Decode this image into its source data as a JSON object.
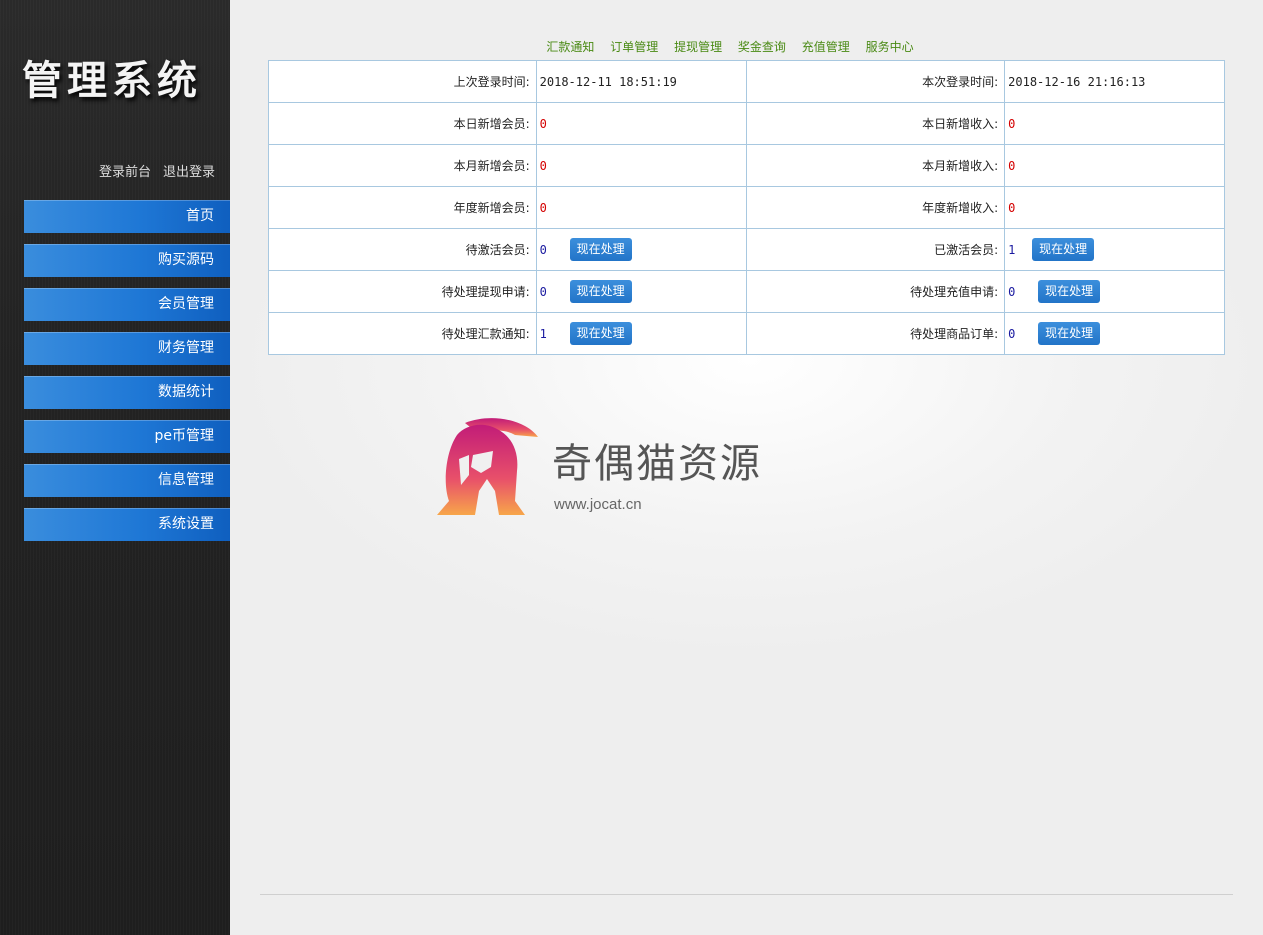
{
  "sidebar": {
    "title": "管理系统",
    "top_links": [
      "登录前台",
      "退出登录"
    ],
    "nav": [
      "首页",
      "购买源码",
      "会员管理",
      "财务管理",
      "数据统计",
      "pe币管理",
      "信息管理",
      "系统设置"
    ]
  },
  "menu": [
    "汇款通知",
    "订单管理",
    "提现管理",
    "奖金查询",
    "充值管理",
    "服务中心"
  ],
  "table": {
    "last_login_label": "上次登录时间:",
    "last_login_value": "2018-12-11 18:51:19",
    "this_login_label": "本次登录时间:",
    "this_login_value": "2018-12-16 21:16:13",
    "today_members_label": "本日新增会员:",
    "today_members_value": "0",
    "today_income_label": "本日新增收入:",
    "today_income_value": "0",
    "month_members_label": "本月新增会员:",
    "month_members_value": "0",
    "month_income_label": "本月新增收入:",
    "month_income_value": "0",
    "year_members_label": "年度新增会员:",
    "year_members_value": "0",
    "year_income_label": "年度新增收入:",
    "year_income_value": "0",
    "pending_activate_label": "待激活会员:",
    "pending_activate_value": "0",
    "activated_label": "已激活会员:",
    "activated_value": "1",
    "pending_withdraw_label": "待处理提现申请:",
    "pending_withdraw_value": "0",
    "pending_recharge_label": "待处理充值申请:",
    "pending_recharge_value": "0",
    "pending_remit_label": "待处理汇款通知:",
    "pending_remit_value": "1",
    "pending_orders_label": "待处理商品订单:",
    "pending_orders_value": "0",
    "action_label": "现在处理"
  },
  "watermark": {
    "text": "奇偶猫资源",
    "url": "www.jocat.cn",
    "icon": "spartan-helmet-icon"
  }
}
